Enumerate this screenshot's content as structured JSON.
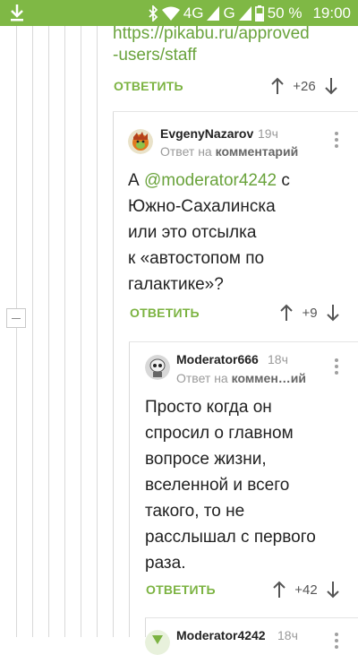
{
  "status_bar": {
    "network": "4G",
    "signal_letter": "G",
    "battery": "50 %",
    "time": "19:00"
  },
  "top_comment": {
    "link_line1": "https://pikabu.ru/approved",
    "link_line2": "-users/staff",
    "reply_label": "ОТВЕТИТЬ",
    "rating": "+26"
  },
  "comments": [
    {
      "author": "EvgenyNazarov",
      "time": "19ч",
      "reply_to_prefix": "Ответ на",
      "reply_to_target": "комментарий",
      "text_prefix": "А ",
      "mention": "@moderator4242",
      "text_suffix": " с",
      "text_lines": [
        "Южно-Сахалинска",
        "или это отсылка",
        "к «автостопом по",
        "галактике»?"
      ],
      "reply_label": "ОТВЕТИТЬ",
      "rating": "+9"
    },
    {
      "author": "Moderator666",
      "time": "18ч",
      "reply_to_prefix": "Ответ на",
      "reply_to_target": "коммен…ий",
      "text_lines": [
        "Просто когда он",
        "спросил о главном",
        "вопросе жизни,",
        "вселенной и всего",
        "такого, то не",
        "расслышал с первого",
        "раза."
      ],
      "reply_label": "ОТВЕТИТЬ",
      "rating": "+42"
    },
    {
      "author": "Moderator4242",
      "time": "18ч"
    }
  ],
  "colors": {
    "accent": "#7cb342",
    "status_bar": "#7fb845"
  }
}
